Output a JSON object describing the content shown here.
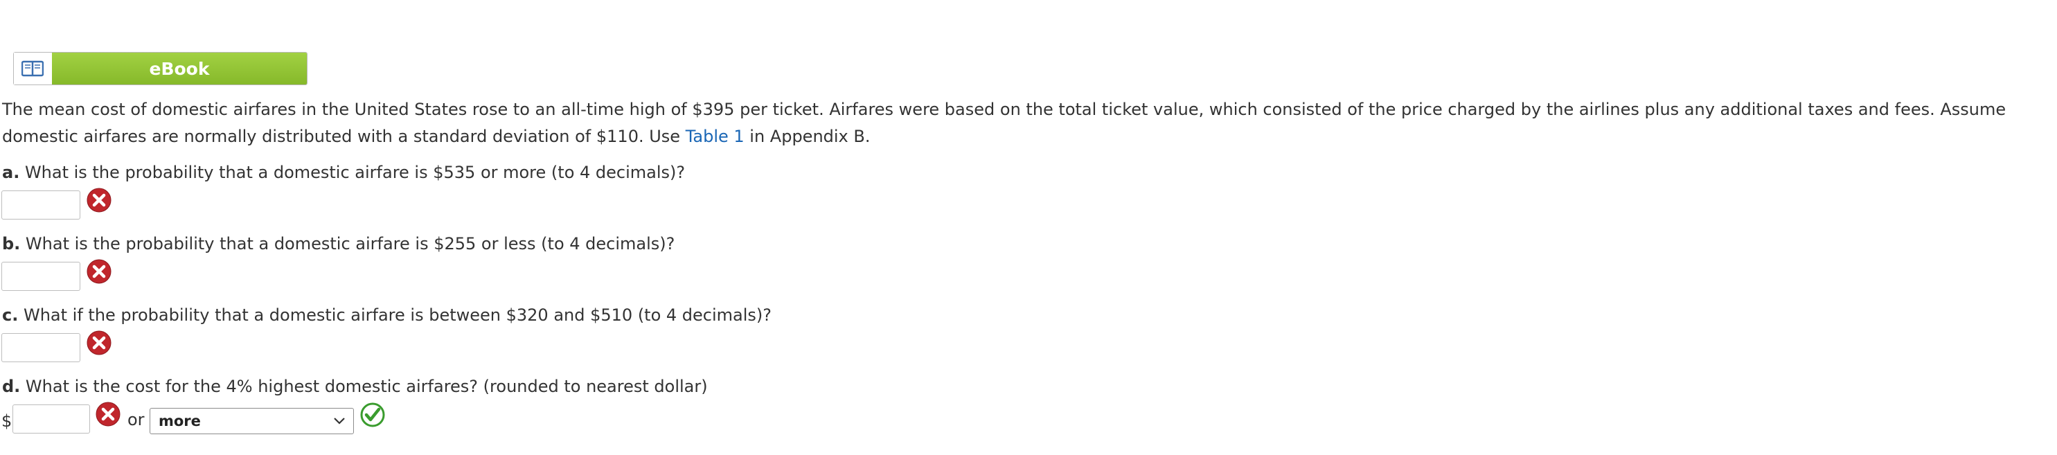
{
  "ebook": {
    "label": "eBook",
    "icon": "open-book-icon"
  },
  "intro": {
    "text_before_link": "The mean cost of domestic airfares in the United States rose to an all-time high of $395 per ticket. Airfares were based on the total ticket value, which consisted of the price charged by the airlines plus any additional taxes and fees. Assume domestic airfares are normally distributed with a standard deviation of $110. Use ",
    "link_text": "Table 1",
    "text_after_link": " in Appendix B."
  },
  "questions": [
    {
      "label": "a.",
      "text": " What is the probability that a domestic airfare is $535 or more (to 4 decimals)?",
      "answer": "",
      "status": "incorrect"
    },
    {
      "label": "b.",
      "text": " What is the probability that a domestic airfare is $255 or less (to 4 decimals)?",
      "answer": "",
      "status": "incorrect"
    },
    {
      "label": "c.",
      "text": " What if the probability that a domestic airfare is between $320 and $510 (to 4 decimals)?",
      "answer": "",
      "status": "incorrect"
    },
    {
      "label": "d.",
      "text": " What is the cost for the 4% highest domestic airfares? (rounded to nearest dollar)",
      "answer": "",
      "status": "incorrect"
    }
  ],
  "question_d": {
    "currency": "$",
    "or_text": "or",
    "select_value": "more",
    "select_status": "correct"
  },
  "colors": {
    "incorrect": "#c0262c",
    "correct": "#3a9c2e",
    "ebook_green": "#93c436",
    "link": "#1a66b5"
  }
}
